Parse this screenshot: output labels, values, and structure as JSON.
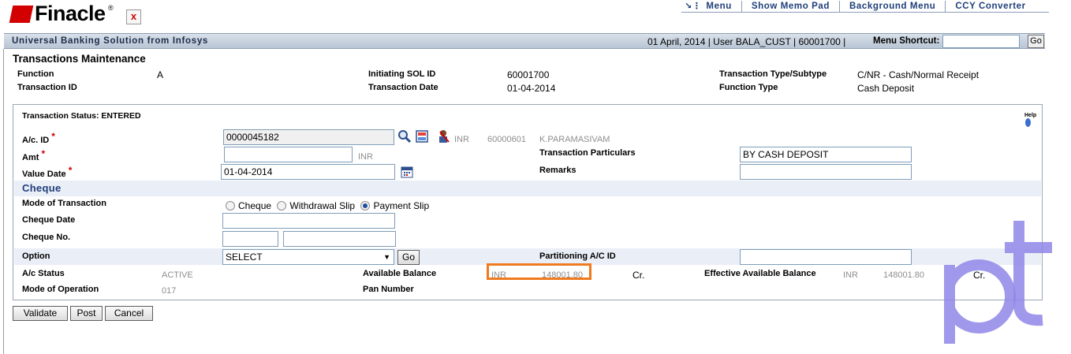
{
  "header": {
    "logo_text": "Finacle",
    "logo_reg": "®",
    "close_glyph": "x",
    "links": [
      "Menu",
      "Show Memo Pad",
      "Background Menu",
      "CCY Converter"
    ]
  },
  "banner": {
    "title": "Universal Banking Solution from Infosys",
    "info": "01 April, 2014 | User BALA_CUST | 60001700 |",
    "menu_shortcut_label": "Menu Shortcut:",
    "menu_shortcut_value": "",
    "go_label": "Go"
  },
  "page": {
    "title": "Transactions Maintenance",
    "function_label": "Function",
    "function_value": "A",
    "transaction_id_label": "Transaction ID",
    "transaction_id_value": "",
    "initiating_sol_label": "Initiating SOL ID",
    "initiating_sol_value": "60001700",
    "transaction_date_label": "Transaction Date",
    "transaction_date_value": "01-04-2014",
    "txn_type_label": "Transaction Type/Subtype",
    "txn_type_value": "C/NR - Cash/Normal Receipt",
    "function_type_label": "Function Type",
    "function_type_value": "Cash Deposit"
  },
  "panel": {
    "status": "Transaction Status: ENTERED",
    "help_label": "Help",
    "account_id_label": "A/c. ID",
    "account_id_value": "0000045182",
    "account_currency": "INR",
    "account_sol": "60000601",
    "account_name": "K.PARAMASIVAM",
    "amt_label": "Amt",
    "amt_value": "",
    "amt_currency": "INR",
    "value_date_label": "Value Date",
    "value_date_value": "01-04-2014",
    "required_marker": "*",
    "txn_particulars_label": "Transaction Particulars",
    "txn_particulars_value": "BY CASH DEPOSIT",
    "remarks_label": "Remarks",
    "remarks_value": "",
    "cheque_section_title": "Cheque",
    "mode_label": "Mode of Transaction",
    "mode_options": [
      "Cheque",
      "Withdrawal Slip",
      "Payment Slip"
    ],
    "mode_selected": "Payment Slip",
    "cheque_date_label": "Cheque Date",
    "cheque_date_value": "",
    "cheque_no_label": "Cheque No.",
    "cheque_no_value_1": "",
    "cheque_no_value_2": "",
    "option_label": "Option",
    "option_value": "SELECT",
    "option_go": "Go",
    "partitioning_label": "Partitioning A/C ID",
    "partitioning_value": "",
    "ac_status_label": "A/c Status",
    "ac_status_value": "ACTIVE",
    "avail_balance_label": "Available Balance",
    "avail_balance_currency": "INR",
    "avail_balance_value": "148001.80",
    "avail_balance_crdr": "Cr.",
    "eff_balance_label": "Effective Available Balance",
    "eff_balance_currency": "INR",
    "eff_balance_value": "148001.80",
    "eff_balance_crdr": "Cr.",
    "mode_of_operation_label": "Mode of Operation",
    "mode_of_operation_value": "017",
    "pan_label": "Pan Number",
    "pan_value": ""
  },
  "actions": {
    "validate": "Validate",
    "post": "Post",
    "cancel": "Cancel"
  },
  "watermark": {
    "text": "pt",
    "color": "#8f86e8"
  },
  "colors": {
    "brand_red": "#d20000",
    "highlight_orange": "#f07a1e",
    "link_blue": "#1e3e78"
  }
}
